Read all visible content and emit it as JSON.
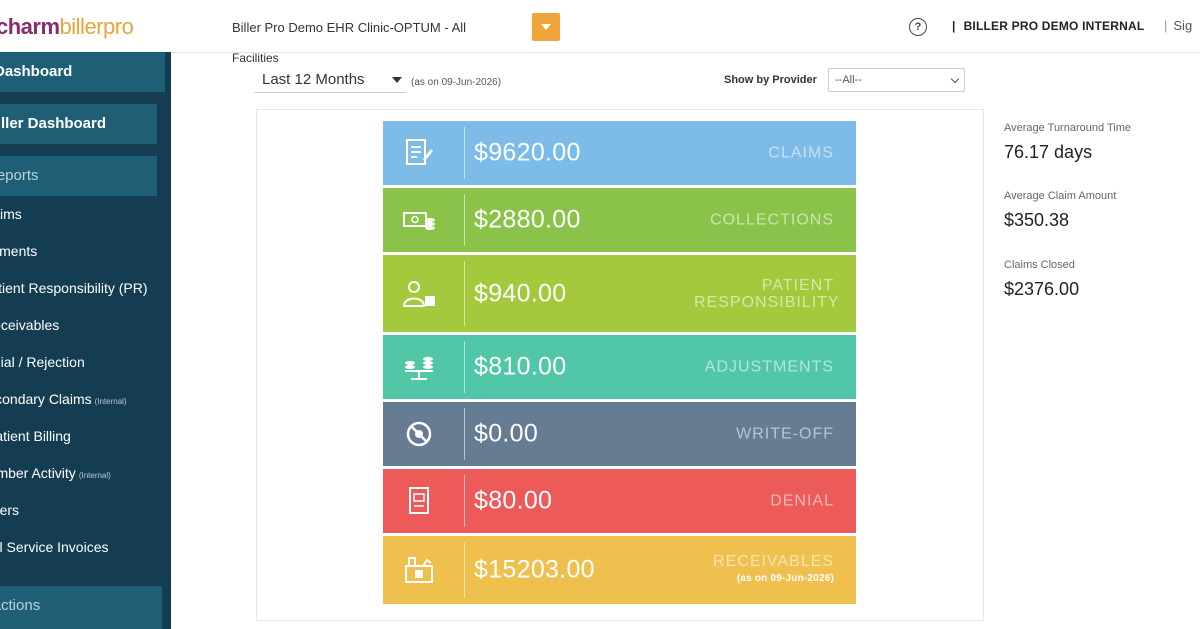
{
  "header": {
    "logo_brand": "charm",
    "logo_rest": "billerpro",
    "facility_selector": "Biller Pro Demo EHR Clinic-OPTUM - All",
    "help_icon": "?",
    "account_name": "BILLER PRO DEMO INTERNAL",
    "sign_out_partial": "Sig"
  },
  "sidebar": {
    "dashboard": "Dashboard",
    "biller_dashboard": "Biller Dashboard",
    "reports_section": "Reports",
    "items": [
      {
        "label": "Claims"
      },
      {
        "label": "Payments"
      },
      {
        "label": "Patient Responsibility (PR)"
      },
      {
        "label": "Receivables"
      },
      {
        "label": "Denial / Rejection"
      },
      {
        "label": "Secondary Claims",
        "tag": "(Internal)"
      },
      {
        "label": "Patient Billing"
      },
      {
        "label": "Member Activity",
        "tag": "(Internal)"
      },
      {
        "label": "Others"
      },
      {
        "label": "Bill Service Invoices"
      }
    ],
    "actions_section": "Actions"
  },
  "filters": {
    "facilities_label": "Facilities",
    "period": "Last 12 Months",
    "as_on": "(as on 09-Jun-2026)",
    "provider_label": "Show by Provider",
    "provider_value": "--All--"
  },
  "tiles": [
    {
      "amount": "$9620.00",
      "label": "CLAIMS",
      "color": "#7dbce8",
      "icon": "claims-icon"
    },
    {
      "amount": "$2880.00",
      "label": "COLLECTIONS",
      "color": "#8bc34a",
      "icon": "collections-icon"
    },
    {
      "amount": "$940.00",
      "label": "PATIENT RESPONSIBILITY",
      "color": "#a4c93d",
      "icon": "patient-responsibility-icon"
    },
    {
      "amount": "$810.00",
      "label": "ADJUSTMENTS",
      "color": "#52c7a8",
      "icon": "adjustments-icon"
    },
    {
      "amount": "$0.00",
      "label": "WRITE-OFF",
      "color": "#667c93",
      "icon": "write-off-icon"
    },
    {
      "amount": "$80.00",
      "label": "DENIAL",
      "color": "#ec5b59",
      "icon": "denial-icon"
    },
    {
      "amount": "$15203.00",
      "label": "RECEIVABLES",
      "sublabel": "(as on 09-Jun-2026)",
      "color": "#f0c04f",
      "icon": "receivables-icon"
    }
  ],
  "stats": [
    {
      "label": "Average Turnaround Time",
      "value": "76.17 days"
    },
    {
      "label": "Average Claim Amount",
      "value": "$350.38"
    },
    {
      "label": "Claims Closed",
      "value": "$2376.00"
    }
  ]
}
